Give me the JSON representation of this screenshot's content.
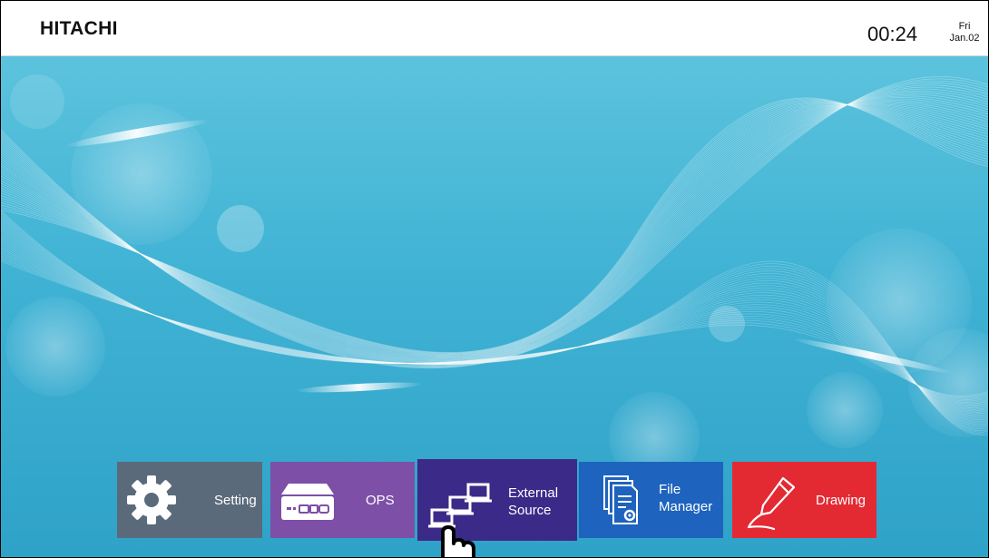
{
  "header": {
    "brand": "HITACHI",
    "time": "00:24",
    "weekday": "Fri",
    "date": "Jan.02"
  },
  "dock": {
    "apps": [
      {
        "label": "Setting",
        "icon": "gear-icon",
        "color": "#5b6a7b"
      },
      {
        "label": "OPS",
        "icon": "ops-device-icon",
        "color": "#7d4fa6"
      },
      {
        "label_line1": "External",
        "label_line2": "Source",
        "icon": "external-source-icon",
        "color": "#3b2a88",
        "selected": true
      },
      {
        "label_line1": "File",
        "label_line2": "Manager",
        "icon": "file-manager-icon",
        "color": "#1e63bd"
      },
      {
        "label": "Drawing",
        "icon": "pen-icon",
        "color": "#e32a33"
      }
    ]
  },
  "pointer": {
    "icon": "hand-pointer-icon"
  }
}
